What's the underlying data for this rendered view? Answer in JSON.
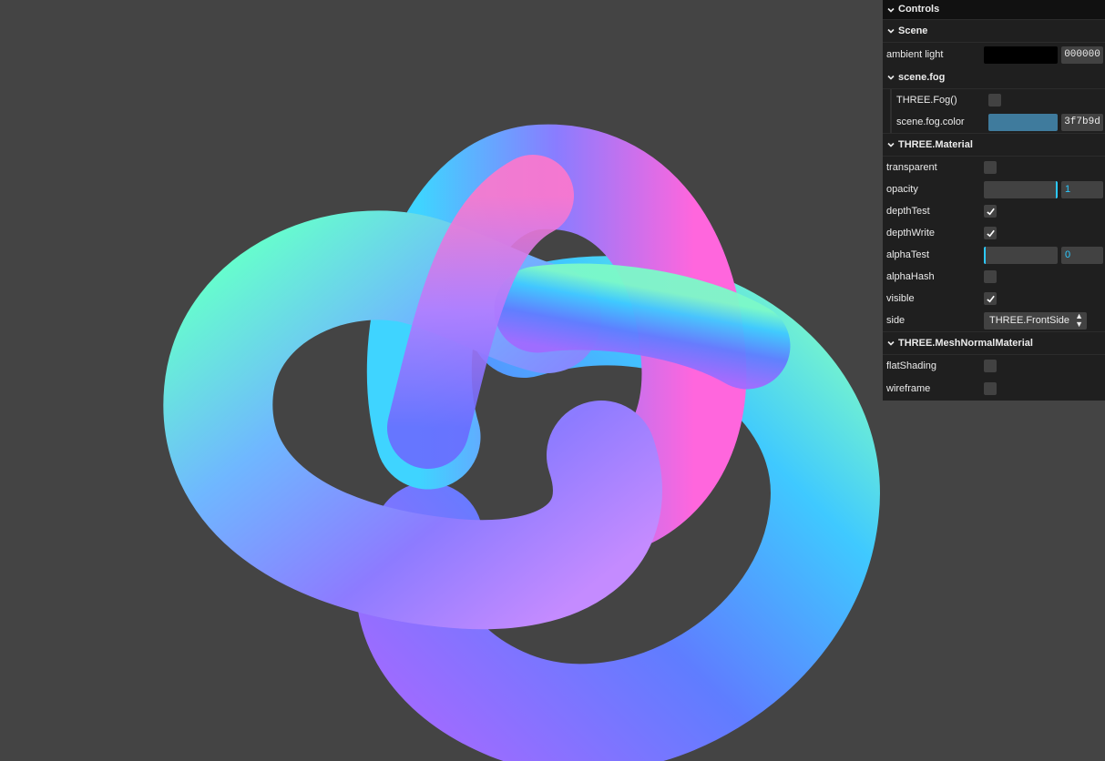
{
  "viewport": {
    "background": "#444444"
  },
  "gui": {
    "title": "Controls",
    "scene": {
      "title": "Scene",
      "ambient_label": "ambient light",
      "ambient_hex": "000000",
      "ambient_color": "#000000",
      "fog": {
        "title": "scene.fog",
        "fog_label": "THREE.Fog()",
        "fog_checked": false,
        "color_label": "scene.fog.color",
        "color_hex": "3f7b9d",
        "color_value": "#3f7b9d"
      }
    },
    "material": {
      "title": "THREE.Material",
      "transparent_label": "transparent",
      "transparent": false,
      "opacity_label": "opacity",
      "opacity_value": "1",
      "depthTest_label": "depthTest",
      "depthTest": true,
      "depthWrite_label": "depthWrite",
      "depthWrite": true,
      "alphaTest_label": "alphaTest",
      "alphaTest_value": "0",
      "alphaHash_label": "alphaHash",
      "alphaHash": false,
      "visible_label": "visible",
      "visible": true,
      "side_label": "side",
      "side_value": "THREE.FrontSide"
    },
    "normal_material": {
      "title": "THREE.MeshNormalMaterial",
      "flatShading_label": "flatShading",
      "flatShading": false,
      "wireframe_label": "wireframe",
      "wireframe": false
    }
  },
  "icons": [
    "chevron-down-icon",
    "check-icon",
    "select-arrows-icon"
  ]
}
